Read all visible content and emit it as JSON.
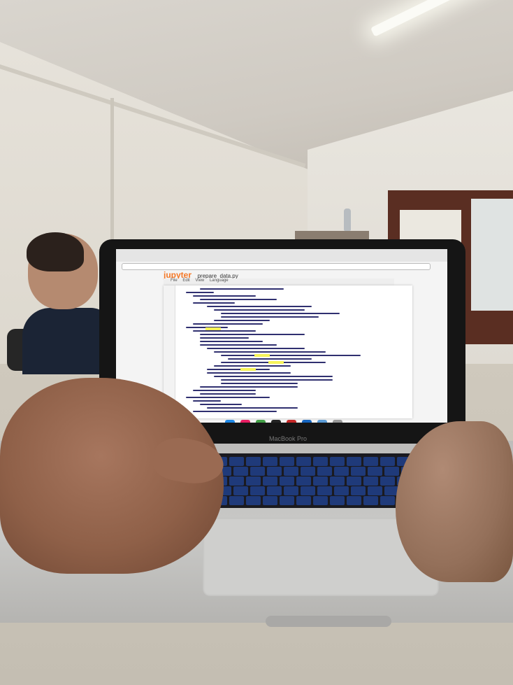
{
  "scene": {
    "description_colors": {
      "wall": "#e3dfd7",
      "desk": "#c9c3b8",
      "door_frame": "#5a2e22",
      "laptop_body": "#c2c1bf",
      "keys": "#1f3a7a",
      "jupyter_orange": "#f37726"
    }
  },
  "laptop": {
    "brand_label": "MacBook Pro",
    "screen": {
      "app_name": "jupyter",
      "file_name": "prepare_data.py",
      "menu": [
        "File",
        "Edit",
        "View",
        "Language"
      ]
    },
    "dock_icons": [
      "skype-icon",
      "itunes-icon",
      "spotify-icon",
      "terminal-icon",
      "filezilla-icon",
      "photoshop-icon",
      "folder-icon",
      "trash-icon"
    ]
  }
}
